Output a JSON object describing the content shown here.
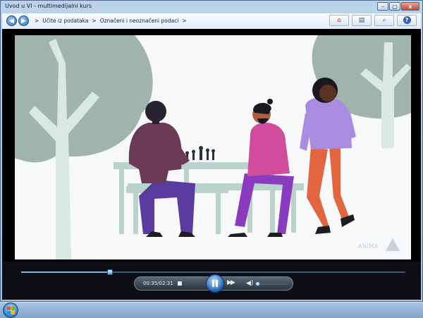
{
  "window": {
    "title": "Uvod u VI - multimedijalni kurs",
    "controls": {
      "minimize": "–",
      "maximize": "▢",
      "close": "x"
    }
  },
  "toolbar": {
    "back_icon": "arrow-left-icon",
    "forward_icon": "arrow-right-icon",
    "breadcrumb": [
      ">",
      "Učite iz podataka",
      ">",
      "Označeni i neoznačeni podaci",
      ">"
    ],
    "buttons": [
      {
        "icon": "home-icon",
        "glyph": "⌂"
      },
      {
        "icon": "print-icon",
        "glyph": "▤"
      },
      {
        "icon": "search-icon",
        "glyph": "⌕"
      },
      {
        "icon": "help-icon",
        "glyph": "?"
      }
    ]
  },
  "video": {
    "watermark": "ANIMA",
    "scene": "people-at-chess-table"
  },
  "player": {
    "time": "00:35/02:31",
    "progress": 0.232,
    "volume": 0.05,
    "state": "playing"
  },
  "colors": {
    "accent": "#2c6db4",
    "tree": "#c9ddd7",
    "table": "#b9d3cc"
  }
}
